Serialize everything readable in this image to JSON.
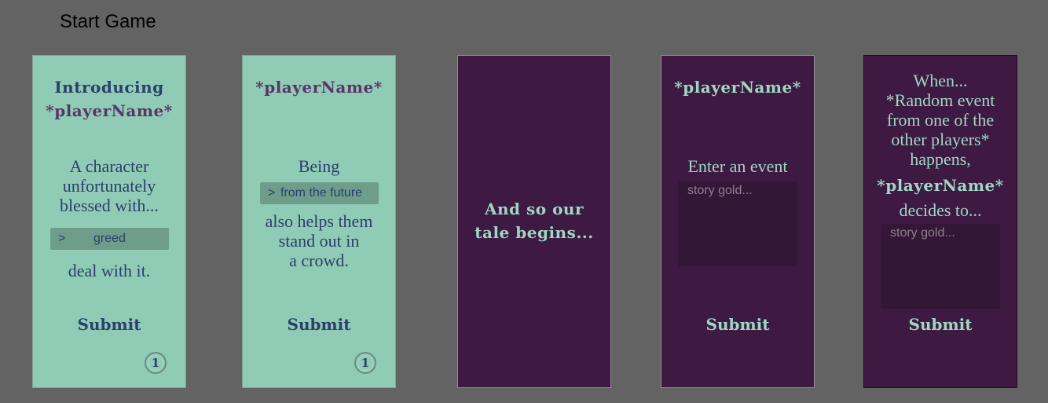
{
  "page_title": "Start Game",
  "cards": [
    {
      "heading_line1": "Introducing",
      "heading_line2": "*playerName*",
      "body_lines": [
        "A character",
        "unfortunately",
        "blessed with..."
      ],
      "select_caret": ">",
      "select_value": "greed",
      "after_text": "deal with it.",
      "submit_label": "Submit",
      "timer_value": "1"
    },
    {
      "heading": "*playerName*",
      "body_line": "Being",
      "select_caret": ">",
      "select_value": "from the future",
      "after_lines": [
        "also helps them",
        "stand out in",
        "a crowd."
      ],
      "submit_label": "Submit",
      "timer_value": "1"
    },
    {
      "heading_lines": [
        "And so our",
        "tale begins..."
      ]
    },
    {
      "heading": "*playerName*",
      "body_line": "Enter an event",
      "placeholder": "story gold...",
      "submit_label": "Submit"
    },
    {
      "body_lines": [
        "When...",
        "*Random event",
        "from one of the",
        "other players*",
        "happens,"
      ],
      "heading": "*playerName*",
      "after_text": "decides to...",
      "placeholder": "story gold...",
      "submit_label": "Submit"
    }
  ]
}
